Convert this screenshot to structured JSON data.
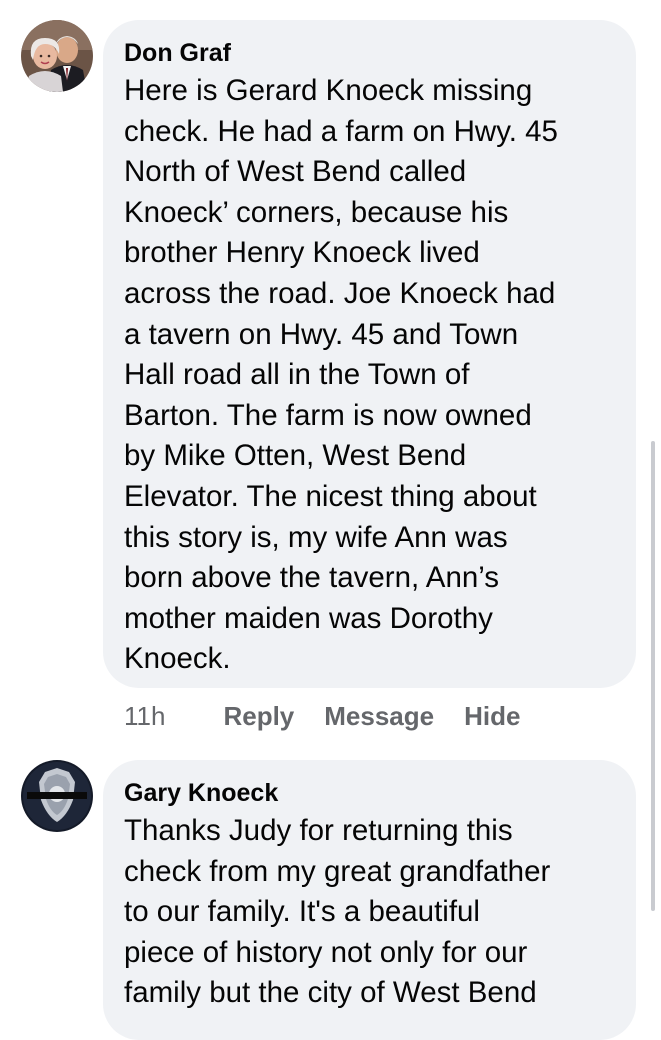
{
  "comments": [
    {
      "author": "Don Graf",
      "avatar_icon": "couple-portrait-avatar",
      "lines": [
        "Here is Gerard Knoeck missing",
        "check. He had a farm on Hwy. 45",
        "North of West Bend called",
        "Knoeck’ corners, because his",
        "brother Henry Knoeck lived",
        "across the road. Joe Knoeck had",
        "a tavern on Hwy. 45 and Town",
        "Hall road all in the Town of",
        "Barton. The farm is now owned",
        "by Mike Otten, West Bend",
        "Elevator. The nicest thing about",
        "this story is, my wife Ann was",
        "born above the tavern, Ann’s",
        "mother maiden was Dorothy",
        "Knoeck."
      ],
      "time": "11h",
      "actions": [
        "Reply",
        "Message",
        "Hide"
      ]
    },
    {
      "author": "Gary Knoeck",
      "avatar_icon": "police-badge-avatar",
      "lines": [
        "Thanks Judy for returning this",
        "check from my great grandfather",
        "to our family. It's a beautiful",
        "piece of history not only for our",
        "family but the city of West Bend"
      ]
    }
  ],
  "colors": {
    "bubble": "#f0f2f5",
    "text": "#050505",
    "meta": "#65676b"
  }
}
